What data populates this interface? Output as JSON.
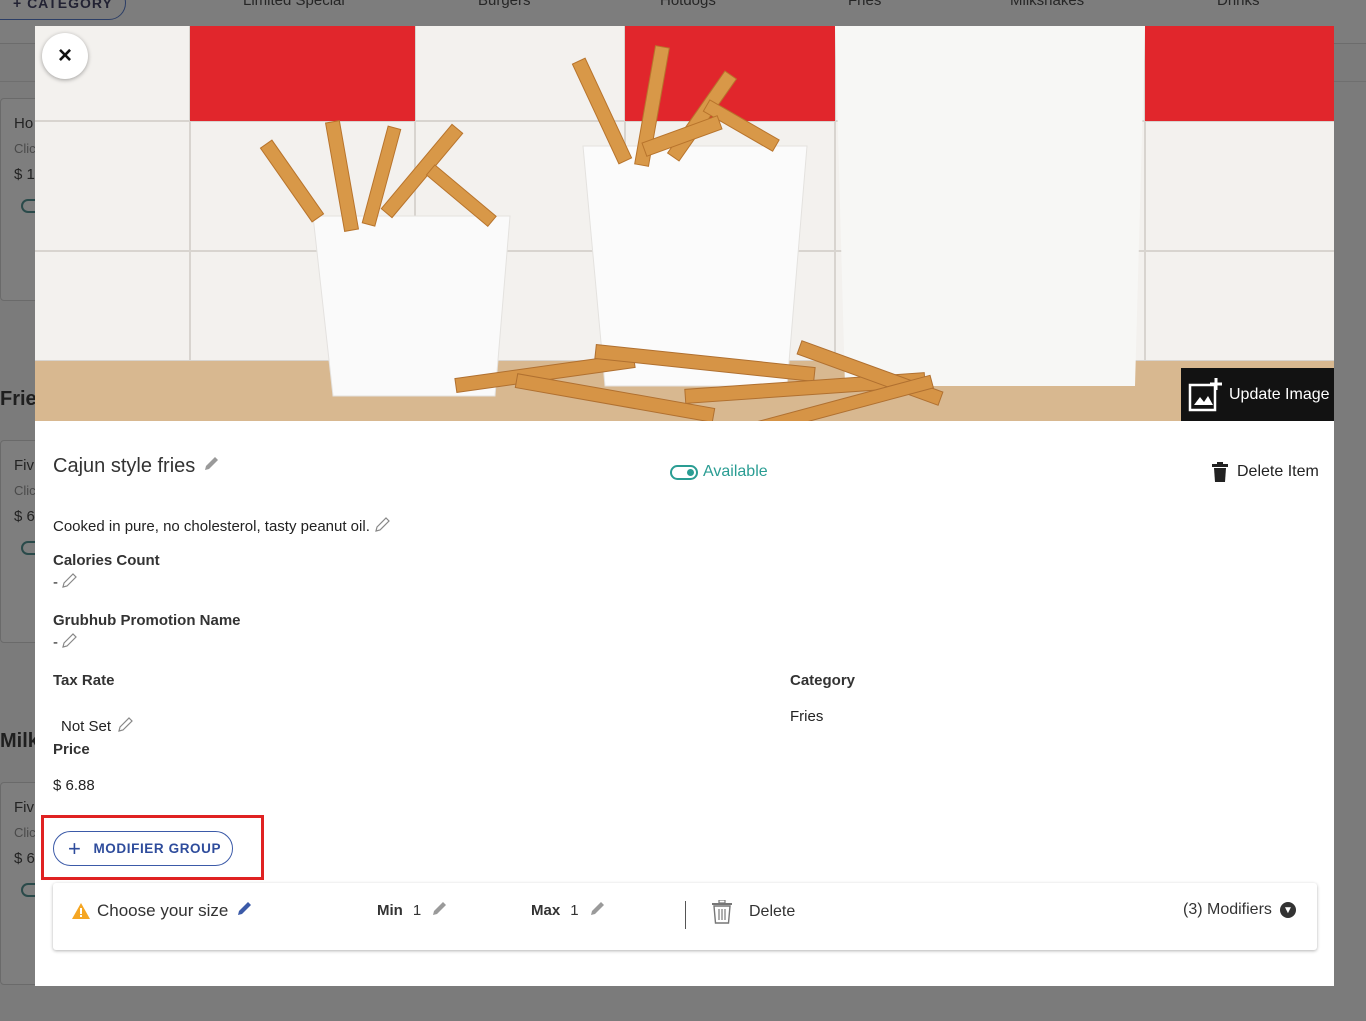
{
  "background": {
    "category_button": "+ CATEGORY",
    "tabs": [
      "Limited Special",
      "Burgers",
      "Hotdogs",
      "Fries",
      "Milkshakes",
      "Drinks"
    ],
    "sections": [
      {
        "heading": "",
        "card_title": "Ho",
        "card_sub": "Clic",
        "card_price": "$ 1"
      },
      {
        "heading": "Frie",
        "card_title": "Fiv",
        "card_sub": "Clic",
        "card_price": "$ 6"
      },
      {
        "heading": "Milk",
        "card_title": "Fiv",
        "card_sub": "Clic",
        "card_price": "$ 6"
      }
    ]
  },
  "modal": {
    "close_label": "×",
    "update_image_label": "Update Image",
    "item_name": "Cajun style fries",
    "availability": "Available",
    "delete_item_label": "Delete Item",
    "description": "Cooked in pure, no cholesterol, tasty peanut oil.",
    "calories": {
      "label": "Calories Count",
      "value": "-"
    },
    "promotion": {
      "label": "Grubhub Promotion Name",
      "value": "-"
    },
    "tax_rate": {
      "label": "Tax Rate",
      "value": "Not Set"
    },
    "category": {
      "label": "Category",
      "value": "Fries"
    },
    "price": {
      "label": "Price",
      "value": "$ 6.88"
    },
    "modifier_group_button": "MODIFIER GROUP",
    "modifier_group": {
      "name": "Choose your size",
      "min_label": "Min",
      "min_value": "1",
      "max_label": "Max",
      "max_value": "1",
      "delete_label": "Delete",
      "modifiers_count": "(3) Modifiers"
    }
  },
  "colors": {
    "accent_teal": "#2a9d93",
    "button_blue": "#3b5aa8",
    "highlight_red": "#e02222",
    "warning_orange": "#f5a623"
  }
}
